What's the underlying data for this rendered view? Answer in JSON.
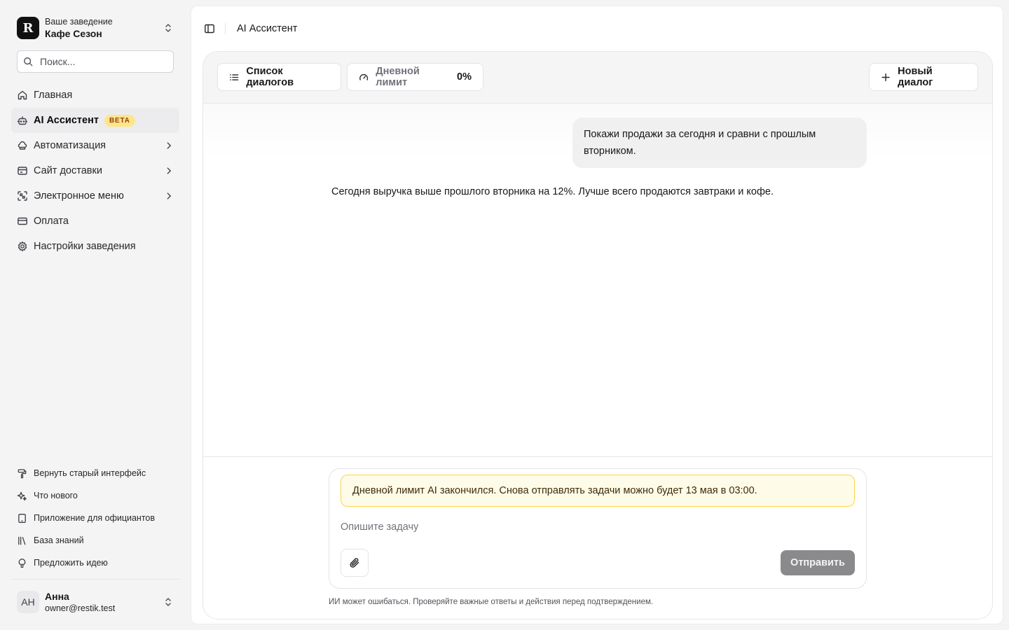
{
  "sidebar": {
    "venue": {
      "logo": "R",
      "caption": "Ваше заведение",
      "name": "Кафе Сезон"
    },
    "search": {
      "placeholder": "Поиск..."
    },
    "nav": [
      {
        "label": "Главная",
        "icon": "home-icon"
      },
      {
        "label": "AI Ассистент",
        "icon": "bot-icon",
        "badge": "BETA",
        "active": true
      },
      {
        "label": "Автоматизация",
        "icon": "chef-hat-icon",
        "expandable": true
      },
      {
        "label": "Сайт доставки",
        "icon": "browser-icon",
        "expandable": true
      },
      {
        "label": "Электронное меню",
        "icon": "qr-scan-icon",
        "expandable": true
      },
      {
        "label": "Оплата",
        "icon": "credit-card-icon"
      },
      {
        "label": "Настройки заведения",
        "icon": "gear-icon"
      }
    ],
    "footer_links": [
      {
        "label": "Вернуть старый интерфейс",
        "icon": "paint-roller-icon"
      },
      {
        "label": "Что нового",
        "icon": "sparkles-icon"
      },
      {
        "label": "Приложение для официантов",
        "icon": "tablet-icon"
      },
      {
        "label": "База знаний",
        "icon": "library-icon"
      },
      {
        "label": "Предложить идею",
        "icon": "lightbulb-icon"
      }
    ],
    "user": {
      "initials": "АН",
      "name": "Анна",
      "email": "owner@restik.test"
    }
  },
  "header": {
    "title": "AI Ассистент"
  },
  "chat": {
    "toolbar": {
      "dialogs_label": "Список диалогов",
      "limit_label": "Дневной лимит",
      "limit_value": "0%",
      "new_dialog_label": "Новый диалог"
    },
    "messages": {
      "user": "Покажи продажи за сегодня и сравни с прошлым вторником.",
      "assistant": "Сегодня выручка выше прошлого вторника на 12%. Лучше всего продаются завтраки и кофе."
    },
    "composer": {
      "alert": "Дневной лимит AI закончился. Снова отправлять задачи можно будет 13 мая в 03:00.",
      "placeholder": "Опишите задачу",
      "send_label": "Отправить"
    },
    "disclaimer": "ИИ может ошибаться. Проверяйте важные ответы и действия перед подтверждением."
  },
  "colors": {
    "accent_badge": "#fde68a",
    "alert_bg": "#fefce8",
    "alert_border": "#fcd34d",
    "send_disabled": "#8a8a8d"
  }
}
